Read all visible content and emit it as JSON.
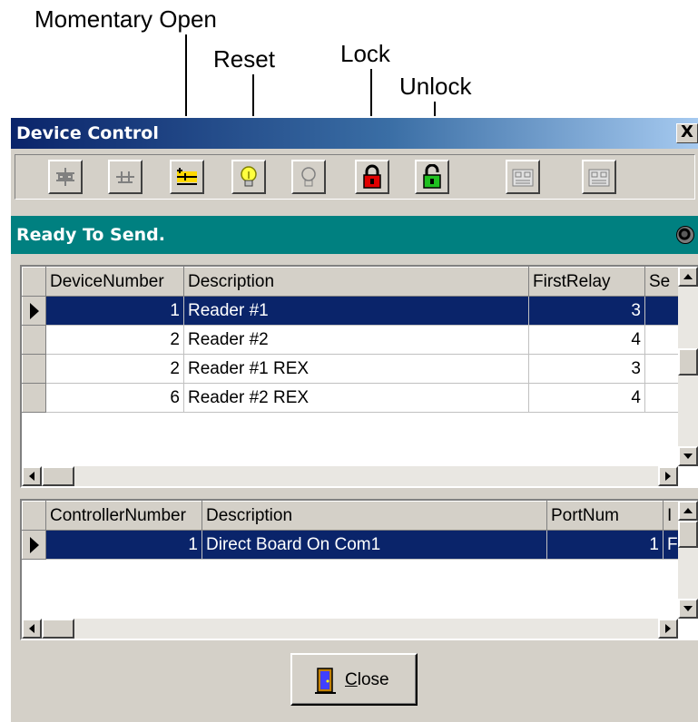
{
  "callouts": {
    "momentary_open": "Momentary Open",
    "reset": "Reset",
    "lock": "Lock",
    "unlock": "Unlock"
  },
  "window": {
    "title": "Device Control",
    "close_glyph": "X"
  },
  "toolbar": {
    "buttons": [
      {
        "icon": "relay-off-icon"
      },
      {
        "icon": "relay-pulse-icon"
      },
      {
        "icon": "momentary-open-icon"
      },
      {
        "icon": "reset-bulb-on-icon"
      },
      {
        "icon": "bulb-off-icon"
      },
      {
        "icon": "lock-icon"
      },
      {
        "icon": "unlock-icon"
      },
      {
        "icon": "controller-board-icon"
      },
      {
        "icon": "controller-board-icon"
      }
    ]
  },
  "status": {
    "text": "Ready To Send.",
    "led_icon": "status-led-icon"
  },
  "devices": {
    "columns": [
      "DeviceNumber",
      "Description",
      "FirstRelay",
      "Se"
    ],
    "rows": [
      {
        "device_number": "1",
        "description": "Reader #1",
        "first_relay": "3",
        "selected": true
      },
      {
        "device_number": "2",
        "description": "Reader #2",
        "first_relay": "4",
        "selected": false
      },
      {
        "device_number": "2",
        "description": "Reader #1 REX",
        "first_relay": "3",
        "selected": false
      },
      {
        "device_number": "6",
        "description": "Reader #2 REX",
        "first_relay": "4",
        "selected": false
      }
    ]
  },
  "controllers": {
    "columns": [
      "ControllerNumber",
      "Description",
      "PortNum",
      "I"
    ],
    "rows": [
      {
        "controller_number": "1",
        "description": "Direct Board On Com1",
        "port_num": "1",
        "extra": "F",
        "selected": true
      }
    ]
  },
  "footer": {
    "close_mnemonic": "C",
    "close_rest": "lose"
  },
  "colors": {
    "title_bar": "#0a246a",
    "status_bar": "#008080",
    "selection": "#0a246a",
    "face": "#d4d0c8"
  }
}
